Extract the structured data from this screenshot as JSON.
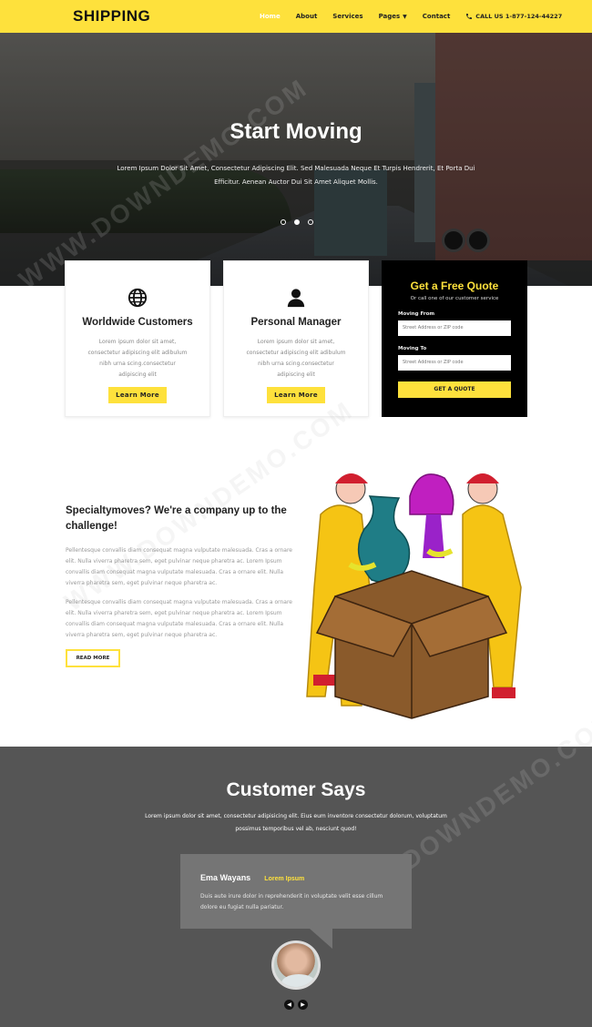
{
  "nav": {
    "logo": "SHIPPING",
    "items": [
      {
        "label": "Home",
        "active": true
      },
      {
        "label": "About"
      },
      {
        "label": "Services"
      },
      {
        "label": "Pages"
      },
      {
        "label": "Contact"
      }
    ],
    "call": "CALL US 1-877-124-44227"
  },
  "hero": {
    "title": "Start Moving",
    "text": "Lorem Ipsum Dolor Sit Amet, Consectetur Adipiscing Elit. Sed Malesuada Neque Et Turpis Hendrerit, Et Porta Dui Efficitur. Aenean Auctor Dui Sit Amet Aliquet Mollis."
  },
  "cards": [
    {
      "title": "Worldwide Customers",
      "icon": "globe-icon",
      "text": "Lorem ipsum dolor sit amet, consectetur adipiscing elit adibulum nibh urna scing.consectetur adipiscing elit",
      "button": "Learn More"
    },
    {
      "title": "Personal Manager",
      "icon": "user-icon",
      "text": "Lorem ipsum dolor sit amet, consectetur adipiscing elit adibulum nibh urna scing.consectetur adipiscing elit",
      "button": "Learn More"
    }
  ],
  "quote": {
    "title": "Get a Free Quote",
    "subtitle": "Or call one of our customer service",
    "from_label": "Moving From",
    "from_placeholder": "Street Address or ZIP code",
    "to_label": "Moving To",
    "to_placeholder": "Street Address or ZIP code",
    "button": "GET A QUOTE"
  },
  "about": {
    "title": "Specialtymoves? We're a company up to the challenge!",
    "para1": "Pellentesque convallis diam consequat magna vulputate malesuada. Cras a ornare elit. Nulla viverra pharetra sem, eget pulvinar neque pharetra ac. Lorem Ipsum convallis diam consequat magna vulputate malesuada. Cras a ornare elit. Nulla viverra pharetra sem, eget pulvinar neque pharetra ac.",
    "para2": "Pellentesque convallis diam consequat magna vulputate malesuada. Cras a ornare elit. Nulla viverra pharetra sem, eget pulvinar neque pharetra ac. Lorem Ipsum convallis diam consequat magna vulputate malesuada. Cras a ornare elit. Nulla viverra pharetra sem, eget pulvinar neque pharetra ac.",
    "button": "READ MORE"
  },
  "testimonials": {
    "title": "Customer Says",
    "lead": "Lorem ipsum dolor sit amet, consectetur adipisicing elit. Eius eum inventore consectetur dolorum, voluptatum possimus temporibus vel ab, nesciunt quod!",
    "name": "Ema Wayans",
    "role": "Lorem Ipsum",
    "quote": "Duis aute irure dolor in reprehenderit in voluptate velit esse cillum dolore eu fugiat nulla pariatur."
  },
  "watermark": "WWW.DOWNDEMO.COM",
  "colors": {
    "accent": "#fee13c",
    "dark": "#000000",
    "section": "#555555"
  }
}
